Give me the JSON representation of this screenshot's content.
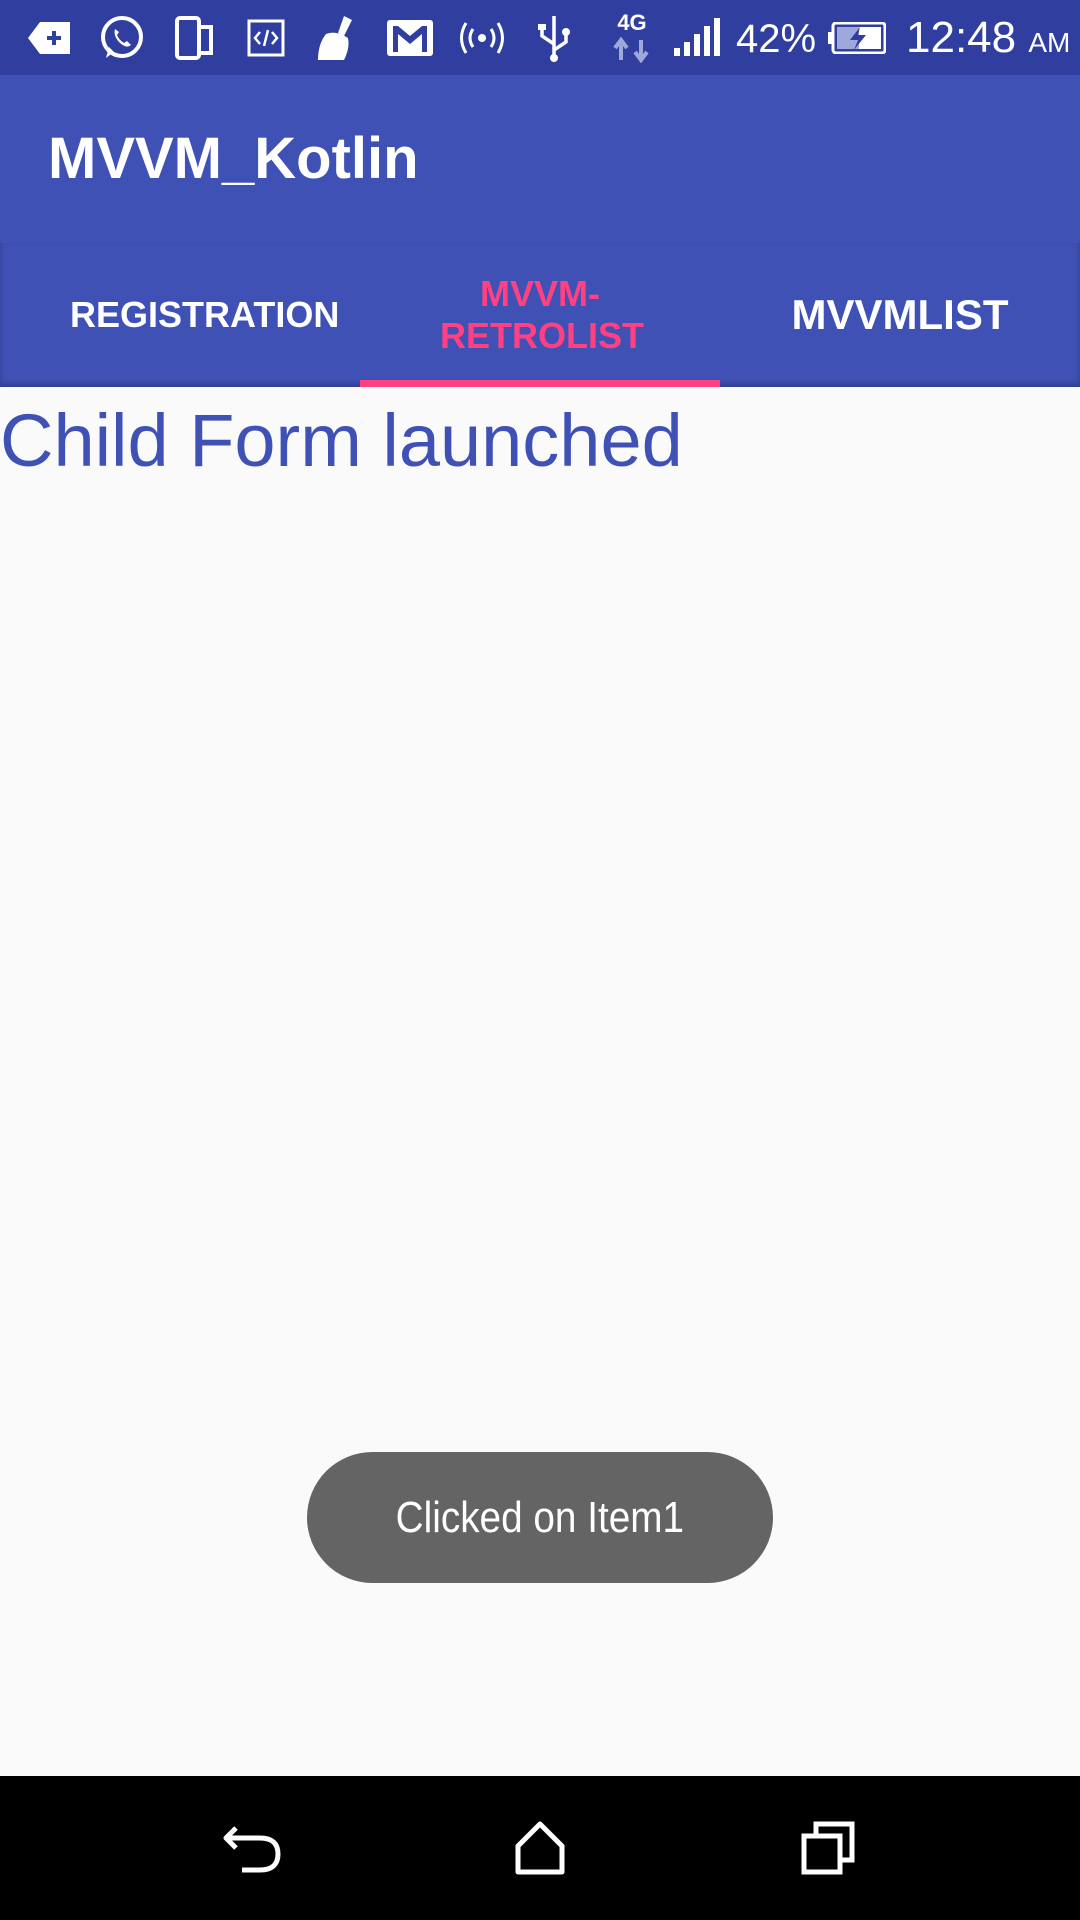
{
  "status_bar": {
    "icons": [
      "notification-add-icon",
      "whatsapp-icon",
      "device-icon",
      "code-icon",
      "cleaner-icon",
      "gmail-icon",
      "hotspot-icon",
      "usb-icon",
      "network-4g-icon",
      "signal-icon",
      "battery-charging-icon"
    ],
    "network_type": "4G",
    "battery_percent": "42%",
    "time": "12:48",
    "ampm": "AM"
  },
  "app_bar": {
    "title": "MVVM_Kotlin"
  },
  "tabs": [
    {
      "label": "REGISTRATION",
      "selected": false
    },
    {
      "label": "MVVM-RETROLIST",
      "selected": true
    },
    {
      "label": "MVVMLIST",
      "selected": false
    }
  ],
  "tab_label_2_line1": "MVVM-",
  "tab_label_2_line2": "RETROLIST",
  "content": {
    "heading": "Child Form launched"
  },
  "toast": {
    "message": "Clicked on Item1"
  },
  "nav_bar": {
    "icons": [
      "back-icon",
      "home-icon",
      "recents-icon"
    ]
  },
  "colors": {
    "status_bar": "#303f9f",
    "primary": "#3f51b5",
    "accent": "#ff4081",
    "background": "#fafafa",
    "toast": "#646464",
    "nav_bar": "#000000"
  }
}
